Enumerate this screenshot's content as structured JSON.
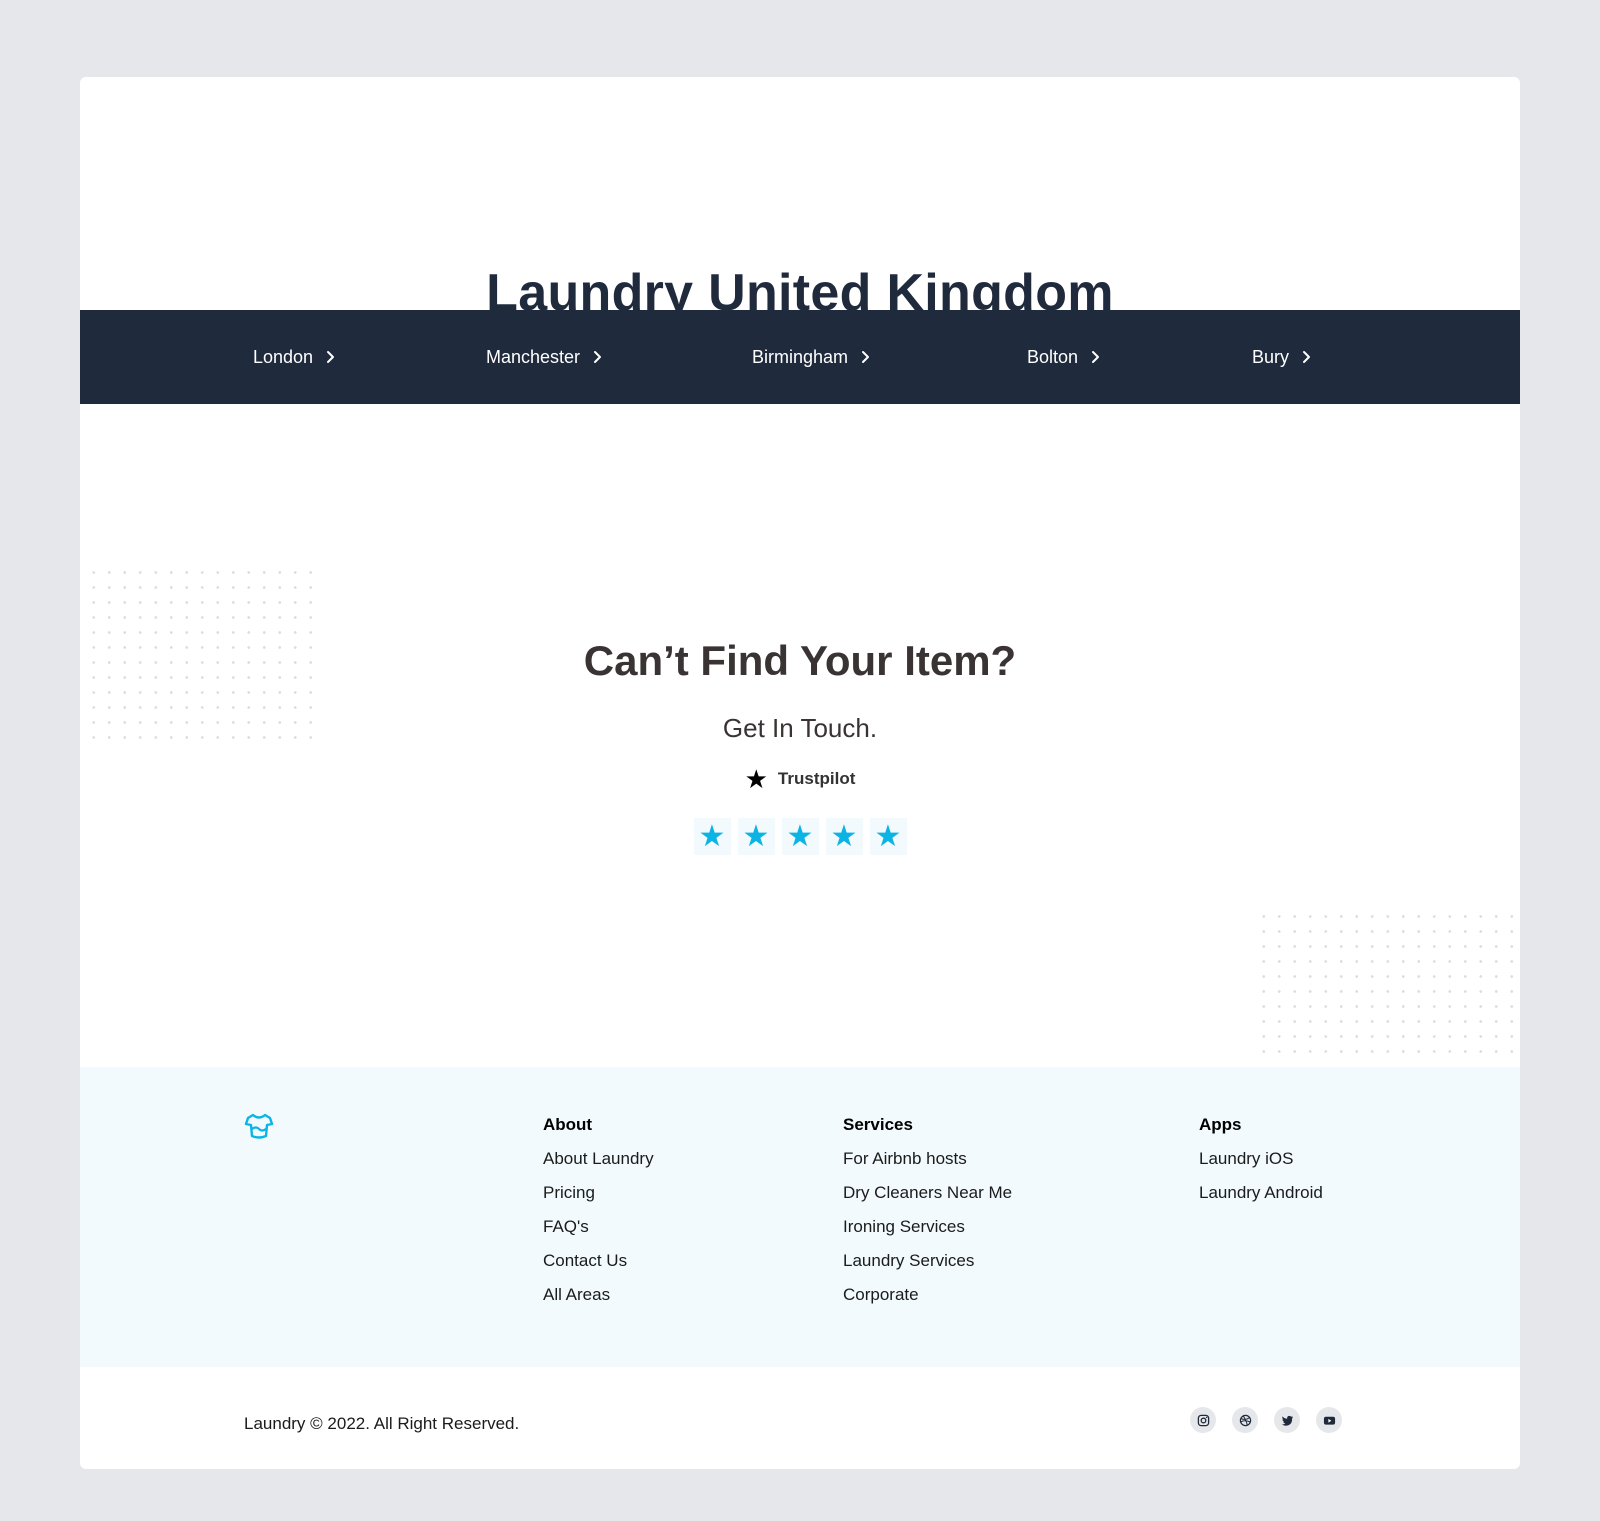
{
  "header": {
    "title": "Laundry United Kingdom"
  },
  "cities": [
    {
      "label": "London"
    },
    {
      "label": "Manchester"
    },
    {
      "label": "Birmingham"
    },
    {
      "label": "Bolton"
    },
    {
      "label": "Bury"
    }
  ],
  "cta": {
    "heading": "Can’t Find Your Item?",
    "subheading": "Get In Touch.",
    "trustpilot_label": "Trustpilot",
    "rating_stars": 5
  },
  "footer": {
    "about": {
      "title": "About",
      "links": [
        "About Laundry",
        "Pricing",
        "FAQ's",
        "Contact Us",
        "All Areas"
      ]
    },
    "services": {
      "title": "Services",
      "links": [
        "For Airbnb hosts",
        "Dry Cleaners Near Me",
        "Ironing Services",
        "Laundry Services",
        "Corporate"
      ]
    },
    "apps": {
      "title": "Apps",
      "links": [
        "Laundry iOS",
        "Laundry Android"
      ]
    },
    "copyright": "Laundry © 2022. All Right Reserved.",
    "socials": [
      "instagram-icon",
      "dribbble-icon",
      "twitter-icon",
      "youtube-icon"
    ]
  },
  "colors": {
    "navy": "#1f2a3c",
    "accent": "#0bb4e4",
    "footer_bg": "#f2fafd",
    "page_bg": "#e5e7eb"
  }
}
